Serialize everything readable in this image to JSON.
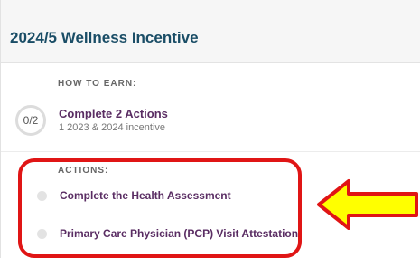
{
  "card": {
    "title": "2024/5 Wellness Incentive"
  },
  "how_to_earn": {
    "label": "HOW TO EARN:",
    "progress": "0/2",
    "title": "Complete 2 Actions",
    "subtitle": "1 2023 & 2024 incentive"
  },
  "actions": {
    "label": "ACTIONS:",
    "items": [
      {
        "label": "Complete the Health Assessment"
      },
      {
        "label": "Primary Care Physician (PCP) Visit Attestation"
      }
    ]
  },
  "colors": {
    "title": "#1a4d66",
    "action_text": "#5a2d63",
    "highlight_border": "#e01515",
    "arrow_fill": "#ffff00",
    "arrow_stroke": "#e01515"
  },
  "icons": {
    "arrow": "left-arrow-icon"
  }
}
